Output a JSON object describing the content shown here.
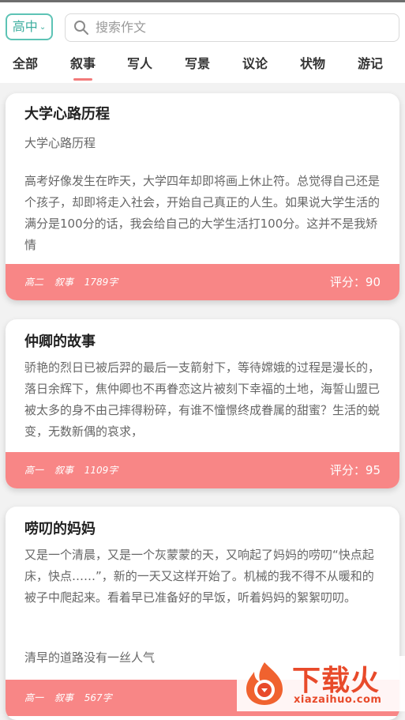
{
  "header": {
    "level_label": "高中",
    "search_placeholder": "搜索作文"
  },
  "tabs": [
    {
      "label": "全部"
    },
    {
      "label": "叙事",
      "active": true
    },
    {
      "label": "写人"
    },
    {
      "label": "写景"
    },
    {
      "label": "议论"
    },
    {
      "label": "状物"
    },
    {
      "label": "游记"
    }
  ],
  "cards": [
    {
      "title": "大学心路历程",
      "subtitle": "大学心路历程",
      "excerpt": "高考好像发生在昨天，大学四年却即将画上休止符。总觉得自己还是个孩子，却即将走入社会，开始自己真正的人生。如果说大学生活的满分是100分的话，我会给自己的大学生活打100分。这并不是我矫情",
      "grade": "高二",
      "genre": "叙事",
      "words": "1789字",
      "score": "评分：90"
    },
    {
      "title": "仲卿的故事",
      "excerpt": "骄艳的烈日已被后羿的最后一支箭射下，等待嫦娥的过程是漫长的，落日余辉下，焦仲卿也不再眷恋这片被刻下幸福的土地，海誓山盟已被太多的身不由己摔得粉碎，有谁不憧憬终成眷属的甜蜜？生活的蜕变，无数新偶的哀求，",
      "grade": "高一",
      "genre": "叙事",
      "words": "1109字",
      "score": "评分：95"
    },
    {
      "title": "唠叨的妈妈",
      "excerpt": "又是一个清晨，又是一个灰蒙蒙的天，又响起了妈妈的唠叨“快点起床，快点……”，新的一天又这样开始了。机械的我不得不从暖和的被子中爬起来。看着早已准备好的早饭，听着妈妈的絮絮叨叨。",
      "excerpt2": "清早的道路没有一丝人气",
      "grade": "高一",
      "genre": "叙事",
      "words": "567字"
    }
  ],
  "watermark": {
    "brand": "下载火",
    "url": "xiazaihuo.com"
  },
  "colors": {
    "accent_teal": "#5dc3b5",
    "card_footer": "#f88686",
    "tab_underline": "#f27a7a",
    "watermark": "#e84a2a"
  }
}
